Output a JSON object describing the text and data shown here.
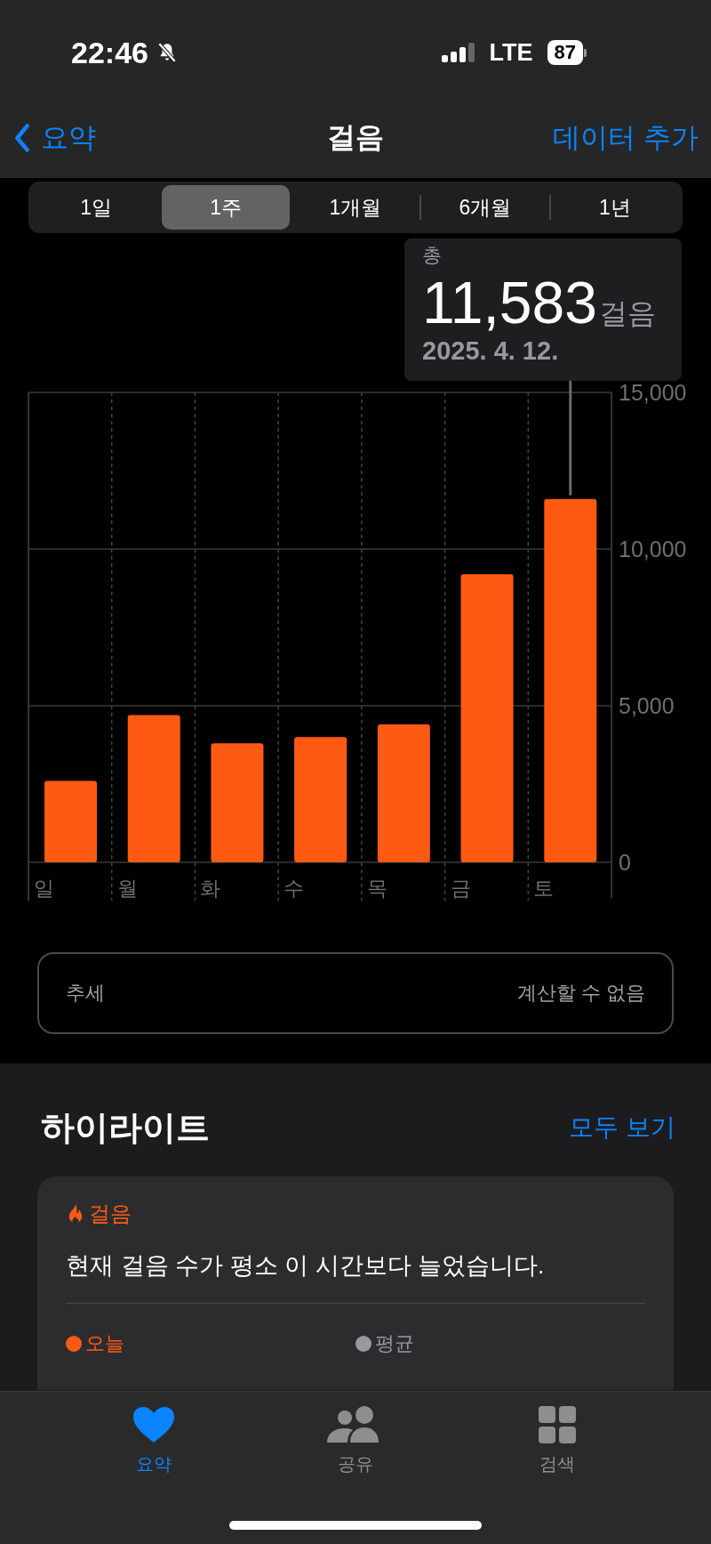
{
  "status_bar": {
    "time": "22:46",
    "network": "LTE",
    "battery": "87"
  },
  "nav": {
    "back": "요약",
    "title": "걸음",
    "action": "데이터 추가"
  },
  "segments": [
    {
      "label": "1일",
      "selected": false
    },
    {
      "label": "1주",
      "selected": true
    },
    {
      "label": "1개월",
      "selected": false
    },
    {
      "label": "6개월",
      "selected": false
    },
    {
      "label": "1년",
      "selected": false
    }
  ],
  "tooltip": {
    "label": "총",
    "value": "11,583",
    "unit": "걸음",
    "date": "2025. 4. 12."
  },
  "chart": {
    "chart_data": {
      "type": "bar",
      "categories": [
        "일",
        "월",
        "화",
        "수",
        "목",
        "금",
        "토"
      ],
      "series": [
        {
          "color": "#ff5a14",
          "values": [
            2600,
            4700,
            3800,
            4000,
            4400,
            9200,
            11600
          ]
        }
      ],
      "ylim": [
        0,
        15000
      ],
      "yticks": [
        {
          "value": 0,
          "label": "0"
        },
        {
          "value": 5000,
          "label": "5,000"
        },
        {
          "value": 10000,
          "label": "10,000"
        },
        {
          "value": 15000,
          "label": "15,000"
        }
      ],
      "annotations": [
        {
          "x": "토"
        }
      ]
    }
  },
  "trend": {
    "label": "추세",
    "value": "계산할 수 없음"
  },
  "highlights": {
    "title": "하이라이트",
    "link": "모두 보기",
    "card": {
      "category": "걸음",
      "message": "현재 걸음 수가 평소 이 시간보다 늘었습니다.",
      "stats": [
        {
          "label": "오늘",
          "color": "#ff5a14"
        },
        {
          "label": "평균",
          "color": "#98989f"
        }
      ]
    }
  },
  "tab_bar": [
    {
      "label": "요약",
      "selected": true,
      "kind": "heart"
    },
    {
      "label": "공유",
      "selected": false,
      "kind": "people"
    },
    {
      "label": "검색",
      "selected": false,
      "kind": "grid"
    }
  ]
}
